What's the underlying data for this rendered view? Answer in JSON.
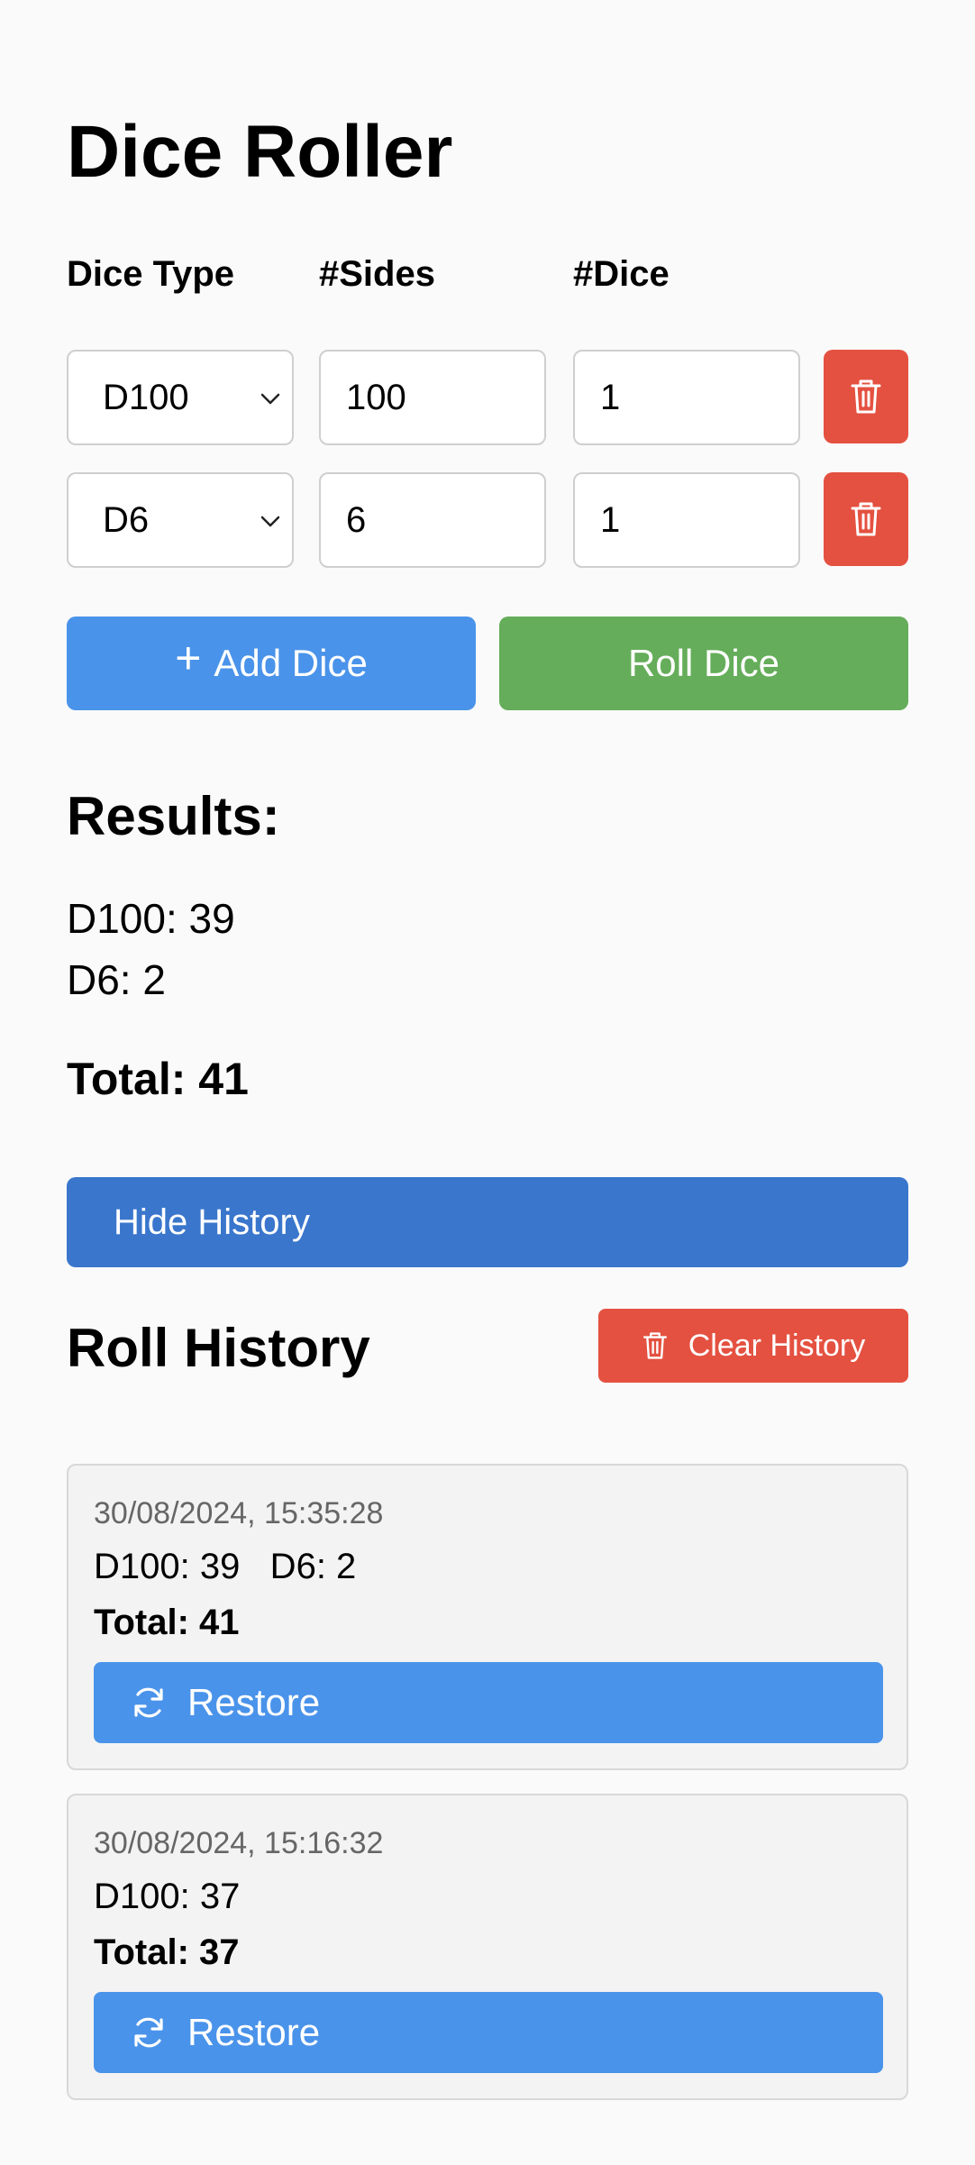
{
  "app": {
    "title": "Dice Roller"
  },
  "columns": {
    "type": "Dice Type",
    "sides": "#Sides",
    "dice": "#Dice"
  },
  "dice_rows": [
    {
      "type": "D100",
      "sides": "100",
      "count": "1"
    },
    {
      "type": "D6",
      "sides": "6",
      "count": "1"
    }
  ],
  "buttons": {
    "add_icon": "+",
    "add": "Add Dice",
    "roll": "Roll Dice",
    "hide_history": "Hide History",
    "clear_history": "Clear History",
    "restore": "Restore"
  },
  "results": {
    "heading": "Results:",
    "lines": [
      "D100: 39",
      "D6: 2"
    ],
    "total": "Total: 41"
  },
  "history": {
    "heading": "Roll History",
    "entries": [
      {
        "timestamp": "30/08/2024, 15:35:28",
        "rolls": "D100: 39   D6: 2",
        "total": "Total: 41"
      },
      {
        "timestamp": "30/08/2024, 15:16:32",
        "rolls": "D100: 37",
        "total": "Total: 37"
      }
    ]
  },
  "colors": {
    "primary": "#4a93ea",
    "success": "#65ad5a",
    "danger": "#e45140",
    "history_toggle": "#3a76cc"
  },
  "icons": {
    "delete": "trash-icon",
    "select": "chevron-down-icon",
    "restore": "refresh-icon",
    "add": "plus-icon"
  }
}
